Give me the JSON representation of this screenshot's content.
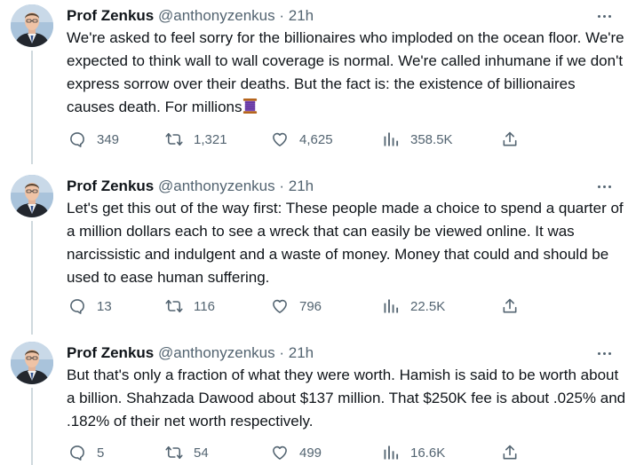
{
  "tweets": [
    {
      "author": "Prof Zenkus",
      "handle": "@anthonyzenkus",
      "dot": "·",
      "time": "21h",
      "text": "We're asked to feel sorry for the billionaires who imploded on the ocean floor. We're expected to think wall to wall coverage is normal. We're called inhumane if we don't express sorrow over their deaths. But the fact is: the existence of billionaires causes death. For millions",
      "emoji": "thread-icon",
      "replies": "349",
      "retweets": "1,321",
      "likes": "4,625",
      "views": "358.5K"
    },
    {
      "author": "Prof Zenkus",
      "handle": "@anthonyzenkus",
      "dot": "·",
      "time": "21h",
      "text": "Let's get this out of the way first: These people made a choice to spend a quarter of a million dollars each to see a wreck that can easily be viewed online. It was narcissistic and indulgent and a waste of money.  Money that could and should be used to ease human suffering.",
      "replies": "13",
      "retweets": "116",
      "likes": "796",
      "views": "22.5K"
    },
    {
      "author": "Prof Zenkus",
      "handle": "@anthonyzenkus",
      "dot": "·",
      "time": "21h",
      "text": "But that's only a fraction of what they were worth. Hamish is said to be worth about a billion. Shahzada Dawood about $137 million. That $250K fee is about .025% and .182% of their net worth respectively.",
      "replies": "5",
      "retweets": "54",
      "likes": "499",
      "views": "16.6K"
    }
  ],
  "colors": {
    "text": "#0f1419",
    "secondary": "#536471",
    "thread_line": "#cfd9de",
    "background": "#ffffff"
  }
}
